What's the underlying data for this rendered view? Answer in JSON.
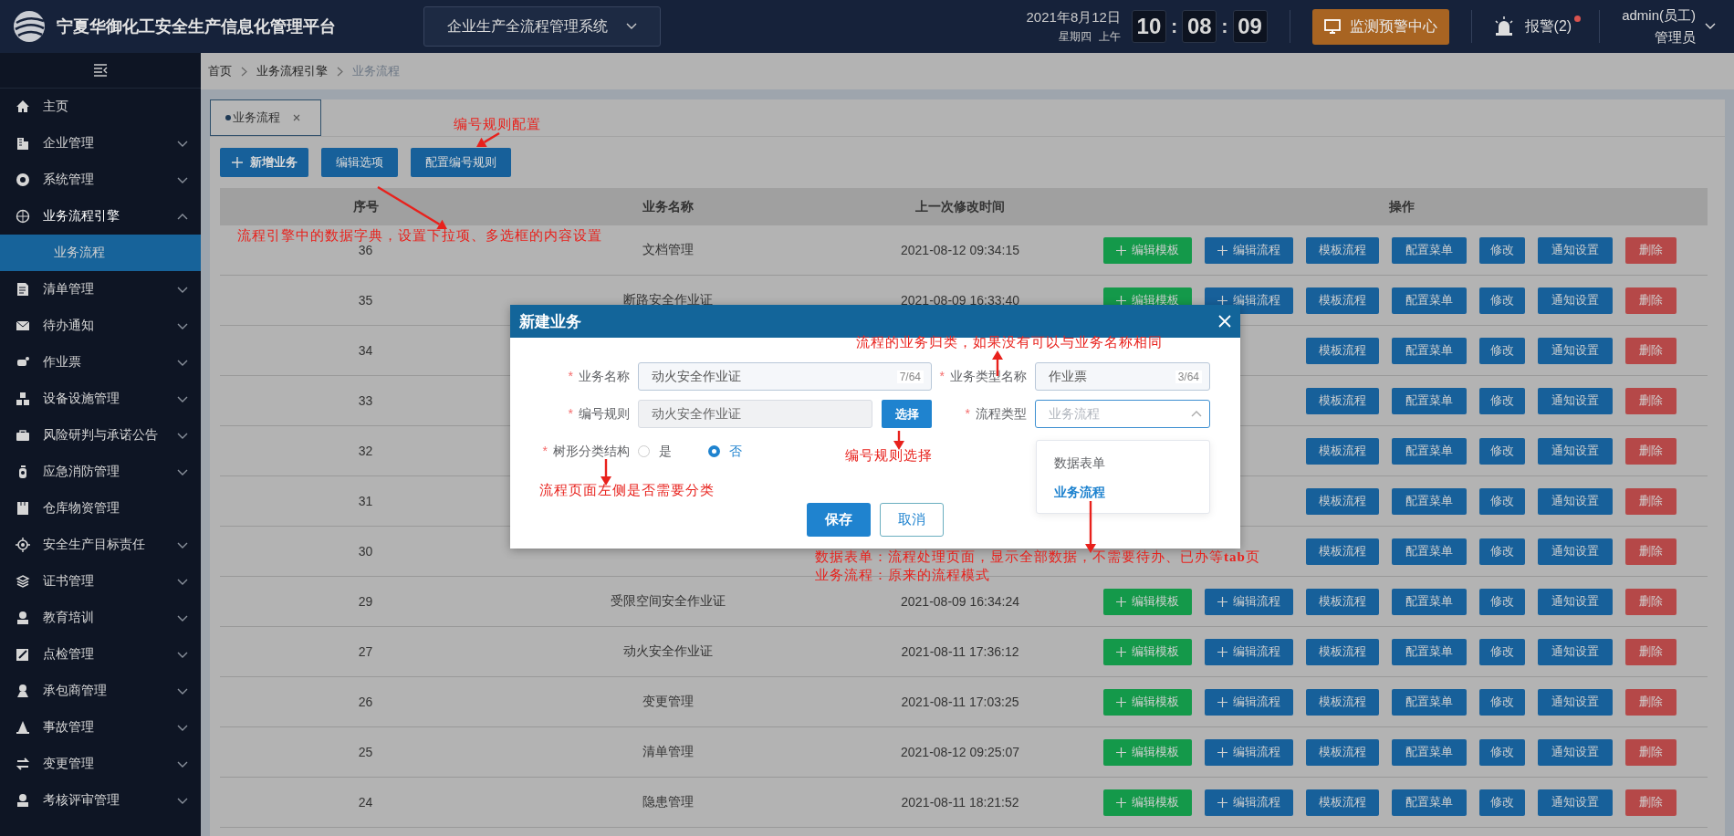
{
  "header": {
    "title": "宁夏华御化工安全生产信息化管理平台",
    "system_select": "企业生产全流程管理系统",
    "date": "2021年8月12日",
    "weekday": "星期四",
    "period": "上午",
    "clock": [
      "10",
      ":",
      "08",
      ":",
      "09"
    ],
    "monitor_button": "监测预警中心",
    "alarm": "报警(2)",
    "alarm_unread": true,
    "user": "admin(员工)",
    "role": "管理员"
  },
  "sidebar": {
    "items": [
      {
        "label": "主页",
        "collapsible": false,
        "selected": false
      },
      {
        "label": "企业管理",
        "collapsible": true,
        "expanded": false,
        "selected": false
      },
      {
        "label": "系统管理",
        "collapsible": true,
        "expanded": false,
        "selected": false
      },
      {
        "label": "业务流程引擎",
        "collapsible": true,
        "expanded": true,
        "selected": false,
        "children": [
          {
            "label": "业务流程",
            "selected": true
          }
        ]
      },
      {
        "label": "清单管理",
        "collapsible": true,
        "expanded": false,
        "selected": false
      },
      {
        "label": "待办通知",
        "collapsible": true,
        "expanded": false,
        "selected": false
      },
      {
        "label": "作业票",
        "collapsible": true,
        "expanded": false,
        "selected": false
      },
      {
        "label": "设备设施管理",
        "collapsible": true,
        "expanded": false,
        "selected": false
      },
      {
        "label": "风险研判与承诺公告",
        "collapsible": true,
        "expanded": false,
        "selected": false
      },
      {
        "label": "应急消防管理",
        "collapsible": true,
        "expanded": false,
        "selected": false
      },
      {
        "label": "仓库物资管理",
        "collapsible": false,
        "selected": false
      },
      {
        "label": "安全生产目标责任",
        "collapsible": true,
        "expanded": false,
        "selected": false
      },
      {
        "label": "证书管理",
        "collapsible": true,
        "expanded": false,
        "selected": false
      },
      {
        "label": "教育培训",
        "collapsible": true,
        "expanded": false,
        "selected": false
      },
      {
        "label": "点检管理",
        "collapsible": true,
        "expanded": false,
        "selected": false
      },
      {
        "label": "承包商管理",
        "collapsible": true,
        "expanded": false,
        "selected": false
      },
      {
        "label": "事故管理",
        "collapsible": true,
        "expanded": false,
        "selected": false
      },
      {
        "label": "变更管理",
        "collapsible": true,
        "expanded": false,
        "selected": false
      },
      {
        "label": "考核评审管理",
        "collapsible": true,
        "expanded": false,
        "selected": false
      }
    ]
  },
  "breadcrumb": [
    {
      "label": "首页",
      "current": false
    },
    {
      "label": "业务流程引擎",
      "current": false
    },
    {
      "label": "业务流程",
      "current": true
    }
  ],
  "tabs": [
    {
      "label": "业务流程",
      "selected": true
    }
  ],
  "toolbar": [
    {
      "label": "新增业务",
      "kind": "add"
    },
    {
      "label": "编辑选项",
      "kind": "plain"
    },
    {
      "label": "配置编号规则",
      "kind": "plain"
    }
  ],
  "table": {
    "columns": [
      "序号",
      "业务名称",
      "上一次修改时间",
      "操作"
    ],
    "rows": [
      {
        "seq": "36",
        "name": "文档管理",
        "time": "2021-08-12 09:34:15",
        "actions": [
          {
            "kind": "template",
            "label": "编辑模板"
          },
          {
            "kind": "flow",
            "label": "编辑流程"
          },
          {
            "kind": "tplflow",
            "label": "模板流程"
          },
          {
            "kind": "menu",
            "label": "配置菜单"
          },
          {
            "kind": "edit",
            "label": "修改"
          },
          {
            "kind": "notify",
            "label": "通知设置"
          },
          {
            "kind": "delete",
            "label": "删除"
          }
        ]
      },
      {
        "seq": "35",
        "name": "断路安全作业证",
        "time": "2021-08-09 16:33:40",
        "actions": [
          {
            "kind": "template",
            "label": "编辑模板"
          },
          {
            "kind": "flow",
            "label": "编辑流程"
          },
          {
            "kind": "tplflow",
            "label": "模板流程"
          },
          {
            "kind": "menu",
            "label": "配置菜单"
          },
          {
            "kind": "edit",
            "label": "修改"
          },
          {
            "kind": "notify",
            "label": "通知设置"
          },
          {
            "kind": "delete",
            "label": "删除"
          }
        ]
      },
      {
        "seq": "34",
        "actions": [
          {
            "kind": "tplflow",
            "label": "模板流程"
          },
          {
            "kind": "menu",
            "label": "配置菜单"
          },
          {
            "kind": "edit",
            "label": "修改"
          },
          {
            "kind": "notify",
            "label": "通知设置"
          },
          {
            "kind": "delete",
            "label": "删除"
          }
        ]
      },
      {
        "seq": "33",
        "actions": [
          {
            "kind": "tplflow",
            "label": "模板流程"
          },
          {
            "kind": "menu",
            "label": "配置菜单"
          },
          {
            "kind": "edit",
            "label": "修改"
          },
          {
            "kind": "notify",
            "label": "通知设置"
          },
          {
            "kind": "delete",
            "label": "删除"
          }
        ]
      },
      {
        "seq": "32",
        "actions": [
          {
            "kind": "tplflow",
            "label": "模板流程"
          },
          {
            "kind": "menu",
            "label": "配置菜单"
          },
          {
            "kind": "edit",
            "label": "修改"
          },
          {
            "kind": "notify",
            "label": "通知设置"
          },
          {
            "kind": "delete",
            "label": "删除"
          }
        ]
      },
      {
        "seq": "31",
        "actions": [
          {
            "kind": "tplflow",
            "label": "模板流程"
          },
          {
            "kind": "menu",
            "label": "配置菜单"
          },
          {
            "kind": "edit",
            "label": "修改"
          },
          {
            "kind": "notify",
            "label": "通知设置"
          },
          {
            "kind": "delete",
            "label": "删除"
          }
        ]
      },
      {
        "seq": "30",
        "actions": [
          {
            "kind": "tplflow",
            "label": "模板流程"
          },
          {
            "kind": "menu",
            "label": "配置菜单"
          },
          {
            "kind": "edit",
            "label": "修改"
          },
          {
            "kind": "notify",
            "label": "通知设置"
          },
          {
            "kind": "delete",
            "label": "删除"
          }
        ]
      },
      {
        "seq": "29",
        "name": "受限空间安全作业证",
        "time": "2021-08-09 16:34:24",
        "actions": [
          {
            "kind": "template",
            "label": "编辑模板"
          },
          {
            "kind": "flow",
            "label": "编辑流程"
          },
          {
            "kind": "tplflow",
            "label": "模板流程"
          },
          {
            "kind": "menu",
            "label": "配置菜单"
          },
          {
            "kind": "edit",
            "label": "修改"
          },
          {
            "kind": "notify",
            "label": "通知设置"
          },
          {
            "kind": "delete",
            "label": "删除"
          }
        ]
      },
      {
        "seq": "27",
        "name": "动火安全作业证",
        "time": "2021-08-11 17:36:12",
        "actions": [
          {
            "kind": "template",
            "label": "编辑模板"
          },
          {
            "kind": "flow",
            "label": "编辑流程"
          },
          {
            "kind": "tplflow",
            "label": "模板流程"
          },
          {
            "kind": "menu",
            "label": "配置菜单"
          },
          {
            "kind": "edit",
            "label": "修改"
          },
          {
            "kind": "notify",
            "label": "通知设置"
          },
          {
            "kind": "delete",
            "label": "删除"
          }
        ]
      },
      {
        "seq": "26",
        "name": "变更管理",
        "time": "2021-08-11 17:03:25",
        "actions": [
          {
            "kind": "template",
            "label": "编辑模板"
          },
          {
            "kind": "flow",
            "label": "编辑流程"
          },
          {
            "kind": "tplflow",
            "label": "模板流程"
          },
          {
            "kind": "menu",
            "label": "配置菜单"
          },
          {
            "kind": "edit",
            "label": "修改"
          },
          {
            "kind": "notify",
            "label": "通知设置"
          },
          {
            "kind": "delete",
            "label": "删除"
          }
        ]
      },
      {
        "seq": "25",
        "name": "清单管理",
        "time": "2021-08-12 09:25:07",
        "actions": [
          {
            "kind": "template",
            "label": "编辑模板"
          },
          {
            "kind": "flow",
            "label": "编辑流程"
          },
          {
            "kind": "tplflow",
            "label": "模板流程"
          },
          {
            "kind": "menu",
            "label": "配置菜单"
          },
          {
            "kind": "edit",
            "label": "修改"
          },
          {
            "kind": "notify",
            "label": "通知设置"
          },
          {
            "kind": "delete",
            "label": "删除"
          }
        ]
      },
      {
        "seq": "24",
        "name": "隐患管理",
        "time": "2021-08-11 18:21:52",
        "actions": [
          {
            "kind": "template",
            "label": "编辑模板"
          },
          {
            "kind": "flow",
            "label": "编辑流程"
          },
          {
            "kind": "tplflow",
            "label": "模板流程"
          },
          {
            "kind": "menu",
            "label": "配置菜单"
          },
          {
            "kind": "edit",
            "label": "修改"
          },
          {
            "kind": "notify",
            "label": "通知设置"
          },
          {
            "kind": "delete",
            "label": "删除"
          }
        ]
      }
    ]
  },
  "dialog": {
    "title": "新建业务",
    "form_rows": [
      {
        "fields": [
          {
            "kind": "text",
            "mark": "*",
            "label": "业务名称",
            "value": "动火安全作业证",
            "counter": "7/64"
          },
          {
            "kind": "text",
            "mark": "*",
            "label": "业务类型名称",
            "value": "作业票",
            "counter": "3/64"
          }
        ]
      },
      {
        "fields": [
          {
            "kind": "picker",
            "mark": "*",
            "label": "编号规则",
            "value": "动火安全作业证",
            "button": "选择",
            "disabled": true
          },
          {
            "kind": "select",
            "mark": "*",
            "label": "流程类型",
            "placeholder": "业务流程",
            "expanded": true,
            "options": [
              {
                "label": "数据表单",
                "selected": false
              },
              {
                "label": "业务流程",
                "selected": true
              }
            ]
          }
        ]
      },
      {
        "fields": [
          {
            "kind": "radio",
            "mark": "*",
            "label": "树形分类结构",
            "options": [
              {
                "label": "是",
                "selected": false
              },
              {
                "label": "否",
                "selected": true
              }
            ]
          }
        ]
      }
    ],
    "buttons": [
      {
        "label": "保存",
        "kind": "primary"
      },
      {
        "label": "取消",
        "kind": "secondary"
      }
    ]
  },
  "annotations": [
    {
      "text": "编号规则配置"
    },
    {
      "text": "流程引擎中的数据字典，设置下拉项、多选框的内容设置"
    },
    {
      "text": "流程的业务归类，如果没有可以与业务名称相同"
    },
    {
      "text": "编号规则选择"
    },
    {
      "text": "流程页面左侧是否需要分类"
    },
    {
      "text": "数据表单：流程处理页面，显示全部数据，不需要待办、已办等**tab**页"
    },
    {
      "text": "业务流程：原来的流程模式"
    }
  ]
}
